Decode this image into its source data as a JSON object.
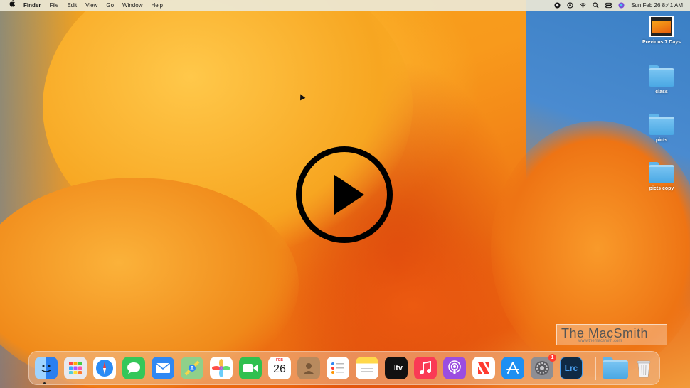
{
  "menubar": {
    "apple": "",
    "app_name": "Finder",
    "menus": [
      "File",
      "Edit",
      "View",
      "Go",
      "Window",
      "Help"
    ],
    "clock": "Sun Feb 26  8:41 AM"
  },
  "desktop": {
    "items": [
      {
        "label": "Previous 7 Days",
        "kind": "screenshot"
      },
      {
        "label": "class",
        "kind": "folder"
      },
      {
        "label": "picts",
        "kind": "folder"
      },
      {
        "label": "picts copy",
        "kind": "folder"
      }
    ]
  },
  "watermark": {
    "text": "The MacSmith",
    "url": "www.themacsmith.com"
  },
  "dock": {
    "apps": [
      {
        "name": "Finder",
        "icon": "finder-icon",
        "color": "#2a8cf0"
      },
      {
        "name": "Launchpad",
        "icon": "launchpad-icon",
        "color": "#e9e9ef"
      },
      {
        "name": "Safari",
        "icon": "safari-icon",
        "color": "#ffffff"
      },
      {
        "name": "Messages",
        "icon": "messages-icon",
        "color": "#34c759"
      },
      {
        "name": "Mail",
        "icon": "mail-icon",
        "color": "#2f88f3"
      },
      {
        "name": "Maps",
        "icon": "maps-icon",
        "color": "#8fd08a"
      },
      {
        "name": "Photos",
        "icon": "photos-icon",
        "color": "#ffffff"
      },
      {
        "name": "FaceTime",
        "icon": "facetime-icon",
        "color": "#30c04f"
      },
      {
        "name": "Calendar",
        "icon": "calendar-icon",
        "color": "#ffffff",
        "month": "FEB",
        "day": "26"
      },
      {
        "name": "Contacts",
        "icon": "contacts-icon",
        "color": "#b88a5e"
      },
      {
        "name": "Reminders",
        "icon": "reminders-icon",
        "color": "#ffffff"
      },
      {
        "name": "Notes",
        "icon": "notes-icon",
        "color": "#ffd84a"
      },
      {
        "name": "TV",
        "icon": "tv-icon",
        "color": "#111111",
        "label": "tv"
      },
      {
        "name": "Music",
        "icon": "music-icon",
        "color": "#fa3a55"
      },
      {
        "name": "Podcasts",
        "icon": "podcasts-icon",
        "color": "#9b4de0"
      },
      {
        "name": "News",
        "icon": "news-icon",
        "color": "#ffffff"
      },
      {
        "name": "App Store",
        "icon": "app-store-icon",
        "color": "#1d8ff2"
      },
      {
        "name": "System Settings",
        "icon": "system-settings-icon",
        "color": "#8e8e93",
        "badge": "1"
      },
      {
        "name": "Lightroom Classic",
        "icon": "lightroom-icon",
        "color": "#0f2a44",
        "label": "Lrc"
      }
    ],
    "downloads": {
      "name": "Downloads",
      "icon": "downloads-folder-icon",
      "color": "#5fb4ea"
    },
    "trash": {
      "name": "Trash",
      "icon": "trash-icon",
      "color": "#e8e8ea"
    }
  },
  "video": {
    "play_icon": "play-button-icon"
  }
}
